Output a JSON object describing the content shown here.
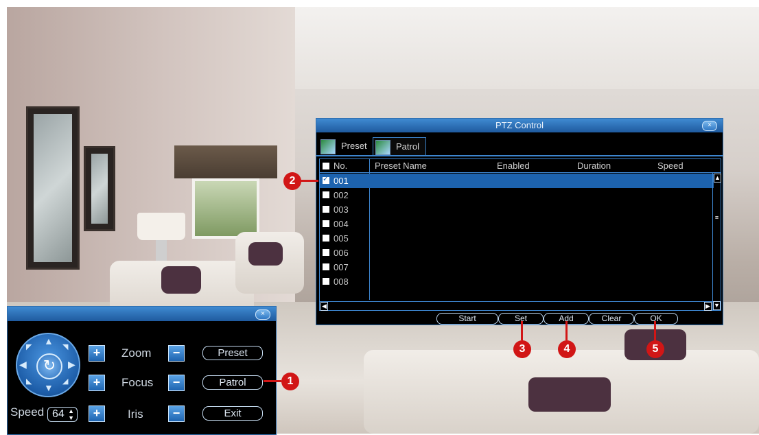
{
  "ptz_window": {
    "title": "PTZ Control",
    "close_glyph": "×",
    "tabs": [
      {
        "label": "Preset",
        "icon": "camera-preset-icon"
      },
      {
        "label": "Patrol",
        "icon": "camera-patrol-icon"
      }
    ],
    "active_tab": "Patrol",
    "columns": [
      "No.",
      "Preset Name",
      "Enabled",
      "Duration",
      "Speed"
    ],
    "rows": [
      {
        "no": "001",
        "checked": true,
        "selected": true
      },
      {
        "no": "002",
        "checked": false,
        "selected": false
      },
      {
        "no": "003",
        "checked": false,
        "selected": false
      },
      {
        "no": "004",
        "checked": false,
        "selected": false
      },
      {
        "no": "005",
        "checked": false,
        "selected": false
      },
      {
        "no": "006",
        "checked": false,
        "selected": false
      },
      {
        "no": "007",
        "checked": false,
        "selected": false
      },
      {
        "no": "008",
        "checked": false,
        "selected": false
      }
    ],
    "buttons": [
      "Start",
      "Set",
      "Add",
      "Clear",
      "OK"
    ]
  },
  "control_panel": {
    "close_glyph": "×",
    "zoom_label": "Zoom",
    "focus_label": "Focus",
    "iris_label": "Iris",
    "speed_label": "Speed",
    "speed_value": "64",
    "preset_button": "Preset",
    "patrol_button": "Patrol",
    "exit_button": "Exit",
    "plus_glyph": "+",
    "minus_glyph": "−"
  },
  "callouts": [
    "1",
    "2",
    "3",
    "4",
    "5"
  ],
  "colors": {
    "accent_blue": "#3d86d0",
    "title_bar": "#2f78c4",
    "selection": "#1d63ae",
    "callout_red": "#d11616"
  }
}
